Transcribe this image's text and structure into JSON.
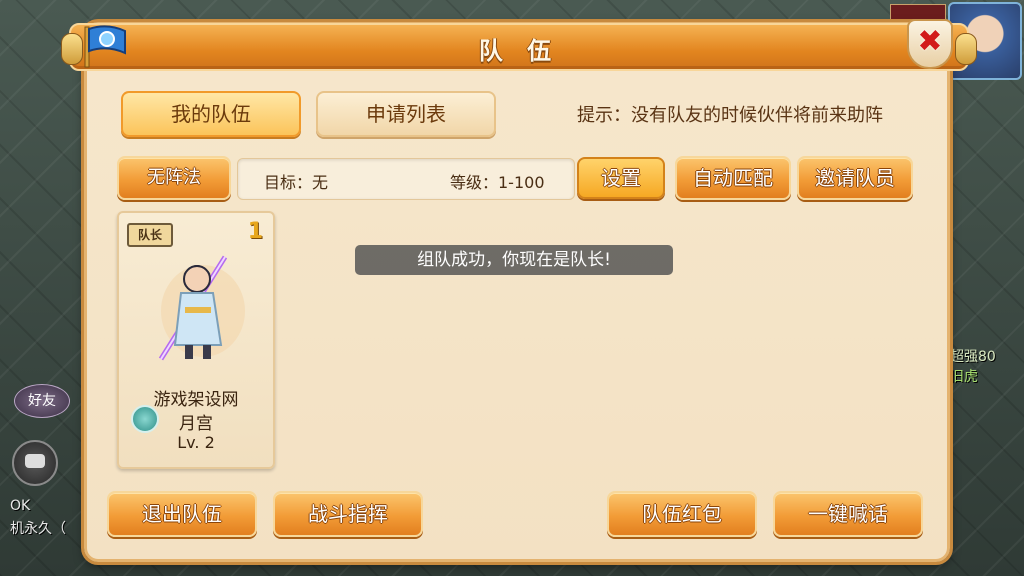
{
  "window": {
    "title": "队 伍",
    "close_label": "✖"
  },
  "tabs": {
    "my_team": "我的队伍",
    "apply_list": "申请列表"
  },
  "hint": "提示：没有队友的时候伙伴将前来助阵",
  "formation_button": "无阵法",
  "target": {
    "goal": "目标：无",
    "level": "等级：1-100"
  },
  "actions": {
    "settings": "设置",
    "auto_match": "自动匹配",
    "invite": "邀请队员"
  },
  "member": {
    "badge": "队长",
    "slot": "1",
    "name": "游戏架设网",
    "school": "月宫",
    "level": "Lv. 2"
  },
  "toast": "组队成功，你现在是队长!",
  "bottom": {
    "leave": "退出队伍",
    "command": "战斗指挥",
    "red_packet": "队伍红包",
    "shout": "一键喊话"
  },
  "background": {
    "friend": "好友",
    "chat1": "OK",
    "chat2": "机永久（",
    "right1": "超强80",
    "right2": "旧虎"
  },
  "icons": {
    "flag": "flag-icon",
    "close": "close-icon",
    "school": "moon-palace-icon",
    "chat": "chat-icon"
  },
  "colors": {
    "panel": "#f6e7cc",
    "title_bar": "#e2851f",
    "button": "#f29c37",
    "close_x": "#d21a1a"
  }
}
